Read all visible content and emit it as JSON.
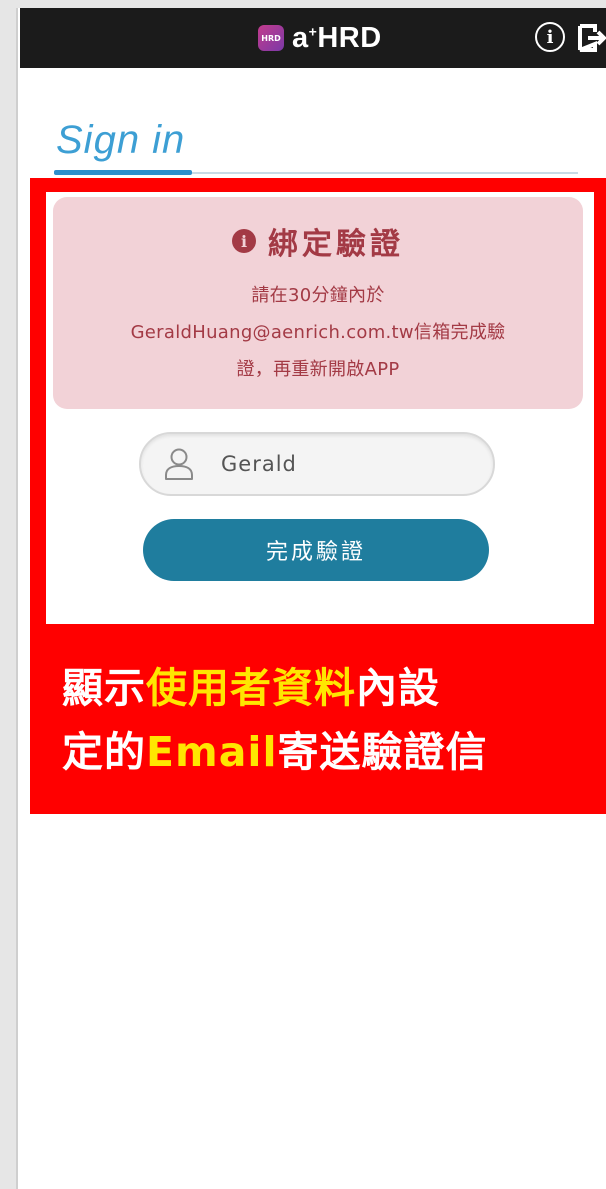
{
  "app_bar": {
    "brand_badge": "a+HRD",
    "brand_prefix": "a",
    "brand_sup": "+",
    "brand_name": "HRD",
    "info_icon": "info-icon",
    "exit_icon": "exit-icon",
    "background": "#1b1b1b"
  },
  "signin": {
    "title": "Sign in",
    "color": "#3d9fd4"
  },
  "verification": {
    "title": "綁定驗證",
    "message_line1": "請在30分鐘內於",
    "message_line2": "GeraldHuang@aenrich.com.tw信箱完成驗",
    "message_line3": "證，再重新開啟APP",
    "card_color": "#f2d2d7",
    "text_color": "#a33a45"
  },
  "form": {
    "username_value": "Gerald",
    "user_icon": "user-icon",
    "submit_label": "完成驗證",
    "button_color": "#1f7d9e"
  },
  "annotation": {
    "line1_a": "顯示",
    "line1_highlight": "使用者資料",
    "line1_b": "內設",
    "line2_a": "定的",
    "line2_highlight": "Email",
    "line2_b": "寄送驗證信",
    "overlay_color": "#ff0000",
    "highlight_color": "#ffe600"
  }
}
